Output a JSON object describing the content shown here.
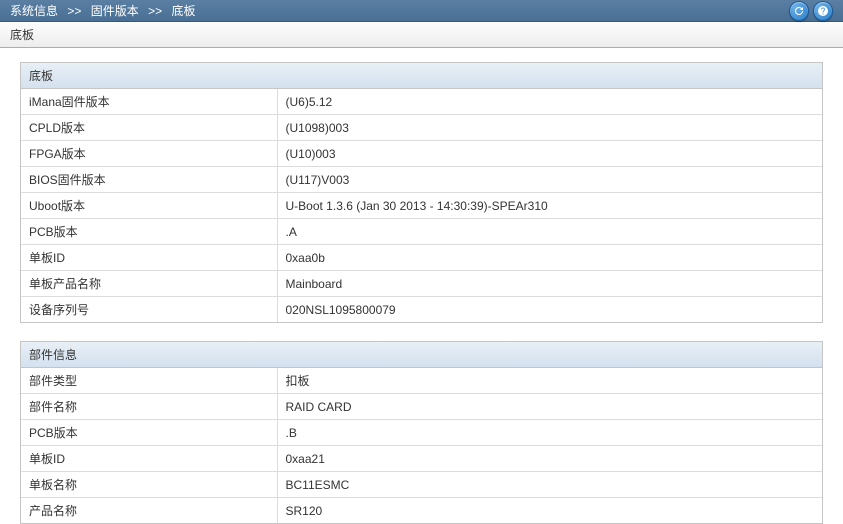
{
  "breadcrumb": {
    "item1": "系统信息",
    "item2": "固件版本",
    "item3": "底板",
    "sep": ">>"
  },
  "subheader": {
    "title": "底板"
  },
  "panel1": {
    "title": "底板",
    "rows": [
      {
        "label": "iMana固件版本",
        "value": "(U6)5.12"
      },
      {
        "label": "CPLD版本",
        "value": "(U1098)003"
      },
      {
        "label": "FPGA版本",
        "value": "(U10)003"
      },
      {
        "label": "BIOS固件版本",
        "value": "(U117)V003"
      },
      {
        "label": "Uboot版本",
        "value": "U-Boot 1.3.6 (Jan 30 2013 - 14:30:39)-SPEAr310"
      },
      {
        "label": "PCB版本",
        "value": ".A"
      },
      {
        "label": "单板ID",
        "value": "0xaa0b"
      },
      {
        "label": "单板产品名称",
        "value": "Mainboard"
      },
      {
        "label": "设备序列号",
        "value": "020NSL1095800079"
      }
    ]
  },
  "panel2": {
    "title": "部件信息",
    "rows": [
      {
        "label": "部件类型",
        "value": "扣板"
      },
      {
        "label": "部件名称",
        "value": "RAID CARD"
      },
      {
        "label": "PCB版本",
        "value": ".B"
      },
      {
        "label": "单板ID",
        "value": "0xaa21"
      },
      {
        "label": "单板名称",
        "value": "BC11ESMC"
      },
      {
        "label": "产品名称",
        "value": "SR120"
      }
    ]
  }
}
